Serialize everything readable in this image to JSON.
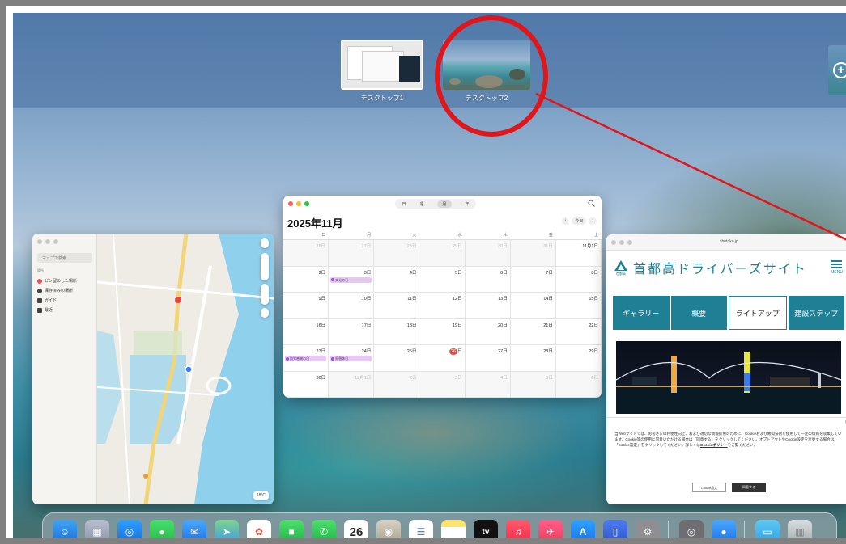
{
  "mission_control": {
    "spaces": [
      {
        "label": "デスクトップ1"
      },
      {
        "label": "デスクトップ2"
      }
    ],
    "add_space_glyph": "+"
  },
  "annotation": {
    "color": "#e0161b"
  },
  "maps": {
    "search_placeholder": "マップで検索",
    "section": "場所",
    "items": [
      "ピン留めした場所",
      "保存済みの場所",
      "ガイド",
      "最近"
    ],
    "weather": "18°C"
  },
  "calendar": {
    "title": "2025年11月",
    "views": [
      "日",
      "週",
      "月",
      "年"
    ],
    "today_button": "今日",
    "weekdays": [
      "日",
      "月",
      "火",
      "水",
      "木",
      "金",
      "土"
    ],
    "weeks": [
      [
        "26日",
        "27日",
        "28日",
        "29日",
        "30日",
        "31日",
        "11月1日"
      ],
      [
        "2日",
        "3日",
        "4日",
        "5日",
        "6日",
        "7日",
        "8日"
      ],
      [
        "9日",
        "10日",
        "11日",
        "12日",
        "13日",
        "14日",
        "15日"
      ],
      [
        "16日",
        "17日",
        "18日",
        "19日",
        "20日",
        "21日",
        "22日"
      ],
      [
        "23日",
        "24日",
        "25日",
        "26日",
        "27日",
        "28日",
        "29日"
      ],
      [
        "30日",
        "12月1日",
        "2日",
        "3日",
        "4日",
        "5日",
        "6日"
      ]
    ],
    "events": {
      "bunka": "文化の日",
      "kinro": "勤労感謝の日",
      "furikae": "振替休日"
    },
    "today_index": "26"
  },
  "safari": {
    "url": "shutoko.jp",
    "site_title": "首都高ドライバーズサイト",
    "logo_caption": "首都高",
    "menu_label": "MENU",
    "tabs": [
      "ギャラリー",
      "概要",
      "ライトアップ",
      "建設ステップ"
    ],
    "active_tab": "ライトアップ",
    "cookie_text_1": "当Webサイトでは、お客さまの利便性向上、および適切な情報提供のために、Cookieおよび類似技術を使用して一定の情報を収集しています。Cookie等の使用に同意いただける場合は「同意する」をクリックしてください。オプトアウトやCookie設定を変更する場合は、「Cookie設定」をクリックしてください。詳しくは",
    "cookie_link": "Cookieポリシー",
    "cookie_text_2": "をご覧ください。",
    "cookie_settings": "Cookie設定",
    "cookie_agree": "同意する",
    "close_glyph": "×"
  },
  "dock": {
    "calendar_day": "26",
    "tv_label": "tv"
  }
}
